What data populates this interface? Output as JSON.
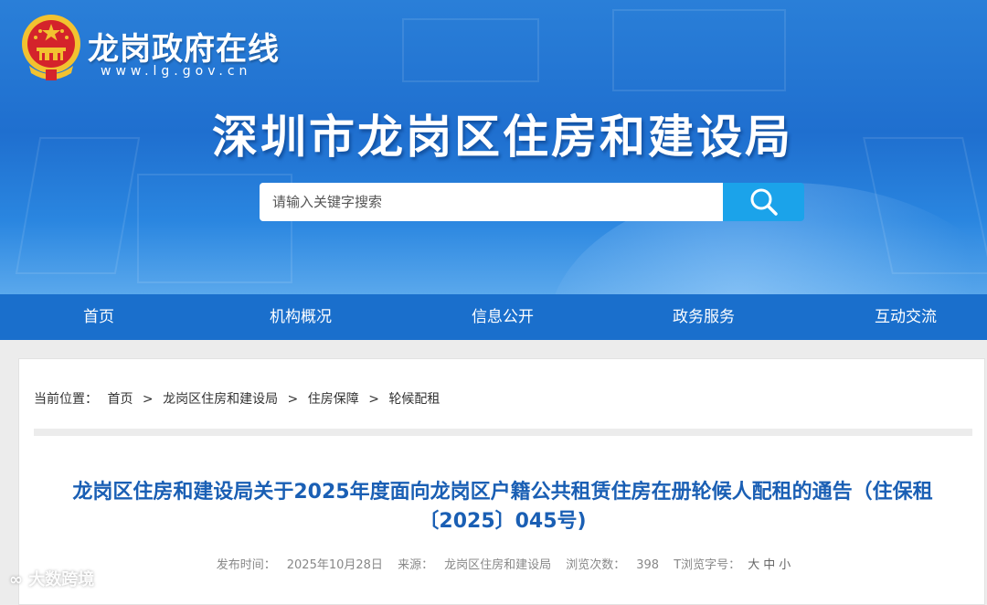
{
  "header": {
    "site_name": "龙岗政府在线",
    "site_url": "www.lg.gov.cn",
    "dept_title": "深圳市龙岗区住房和建设局"
  },
  "search": {
    "placeholder": "请输入关键字搜索"
  },
  "nav": {
    "items": [
      {
        "label": "首页"
      },
      {
        "label": "机构概况"
      },
      {
        "label": "信息公开"
      },
      {
        "label": "政务服务"
      },
      {
        "label": "互动交流"
      }
    ]
  },
  "breadcrumb": {
    "prefix": "当前位置：",
    "items": [
      "首页",
      "龙岗区住房和建设局",
      "住房保障",
      "轮候配租"
    ],
    "separator": ">"
  },
  "article": {
    "title": "龙岗区住房和建设局关于2025年度面向龙岗区户籍公共租赁住房在册轮候人配租的通告（住保租〔2025〕045号)",
    "publish_label": "发布时间：",
    "publish_date": "2025年10月28日",
    "source_label": "来源：",
    "source": "龙岗区住房和建设局",
    "views_label": "浏览次数：",
    "views": "398",
    "fontsize_label": "T浏览字号：",
    "fontsize_options": [
      "大",
      "中",
      "小"
    ]
  },
  "watermark": {
    "text": "大数跨境"
  },
  "colors": {
    "nav_bg": "#1a6fcc",
    "search_btn": "#1ba3ea",
    "title_blue": "#1a5fb4"
  }
}
